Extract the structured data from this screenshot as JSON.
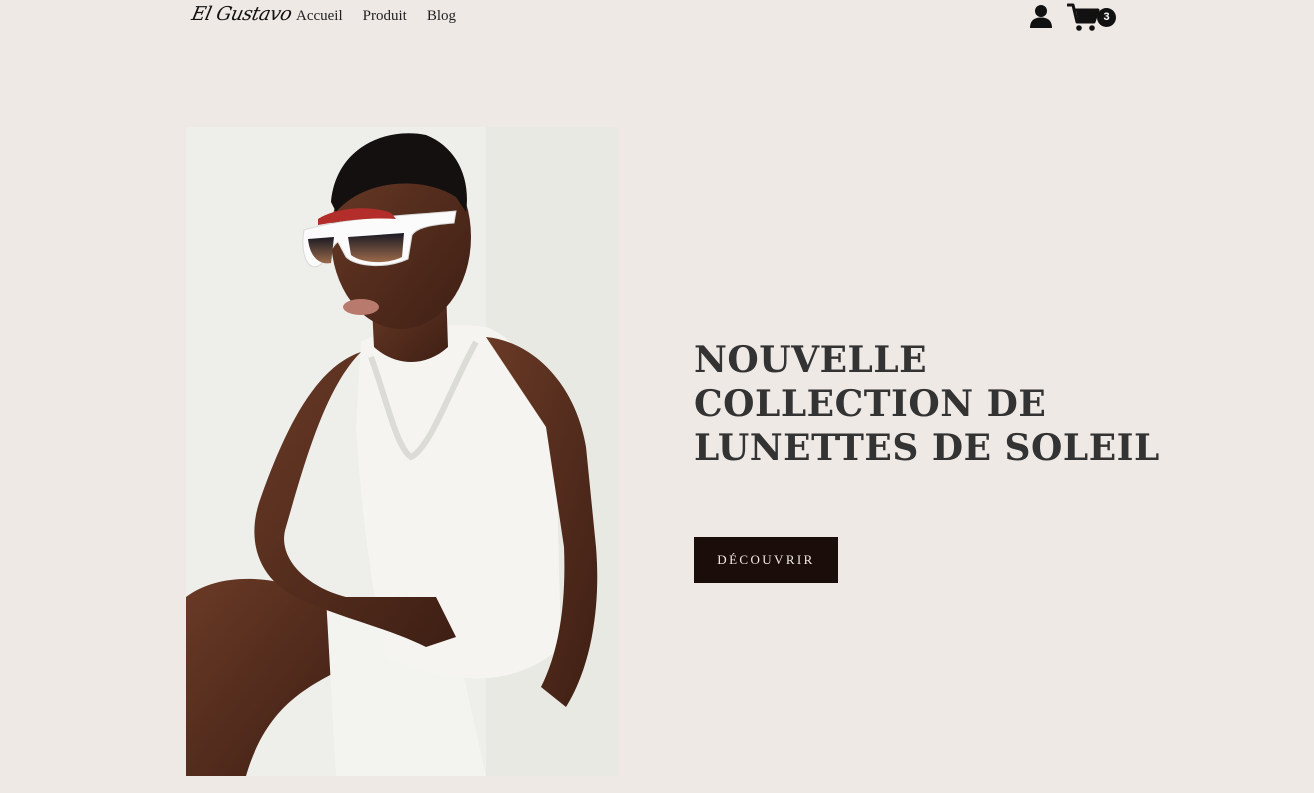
{
  "nav": {
    "logo": "El Gustavo",
    "links": [
      "Accueil",
      "Produit",
      "Blog"
    ],
    "user_icon": "user-icon",
    "cart_icon": "cart-icon",
    "cart_count": "3"
  },
  "hero": {
    "title_lines": [
      "NOUVELLE",
      "COLLECTION DE",
      "LUNETTES DE SOLEIL"
    ],
    "cta_label": "DÉCOUVRIR",
    "image_subject": "model wearing white sunglasses and white lace top"
  },
  "colors": {
    "background": "#efe9e6",
    "cta_background": "#1b0d09",
    "title_text": "#333333"
  }
}
